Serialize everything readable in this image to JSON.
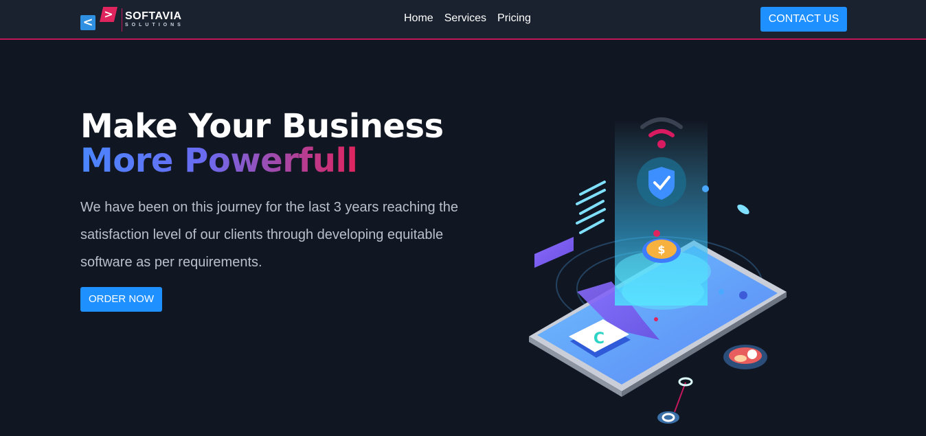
{
  "brand": {
    "name": "SOFTAVIA",
    "tagline": "SOLUTIONS"
  },
  "nav": {
    "items": [
      "Home",
      "Services",
      "Pricing"
    ],
    "contact_label": "CONTACT US"
  },
  "hero": {
    "title_line1": "Make Your Business",
    "title_line2": "More Powerfull",
    "description": "We have been on this journey for the last 3 years reaching the satisfaction level of our clients through developing equitable software as per requirements.",
    "cta_label": "ORDER NOW"
  },
  "colors": {
    "accent": "#1e90ff",
    "brand_pink": "#e0245e",
    "background": "#111722",
    "nav_bg": "#1a2230"
  },
  "icons": [
    "wifi-icon",
    "shield-check-icon",
    "dollar-coin-icon",
    "phone-call-icon",
    "user-avatar-icon"
  ]
}
